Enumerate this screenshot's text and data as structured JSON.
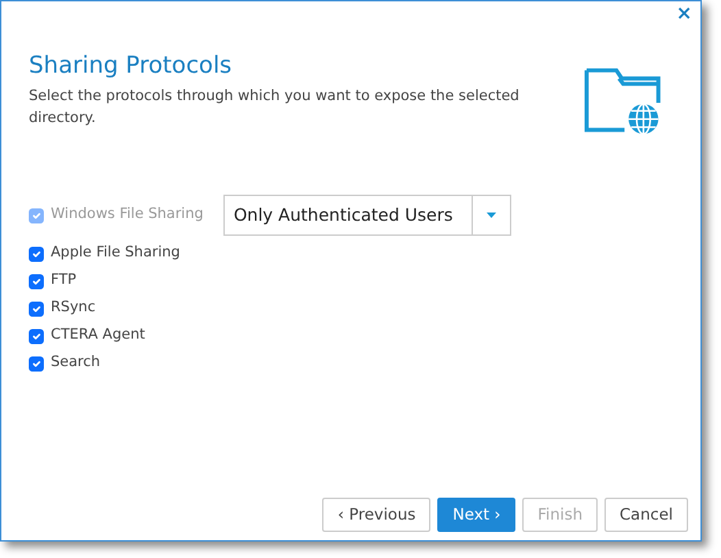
{
  "close": "×",
  "title": "Sharing Protocols",
  "subtitle": "Select the protocols through which you want to expose the selected directory.",
  "protocols": [
    {
      "label": "Windows File Sharing",
      "checked": true,
      "disabled": true,
      "select": {
        "value": "Only Authenticated Users"
      }
    },
    {
      "label": "Apple File Sharing",
      "checked": true,
      "disabled": false
    },
    {
      "label": "FTP",
      "checked": true,
      "disabled": false
    },
    {
      "label": "RSync",
      "checked": true,
      "disabled": false
    },
    {
      "label": "CTERA Agent",
      "checked": true,
      "disabled": false
    },
    {
      "label": "Search",
      "checked": true,
      "disabled": false
    }
  ],
  "buttons": [
    {
      "label": "‹ Previous",
      "kind": "default",
      "disabled": false
    },
    {
      "label": "Next ›",
      "kind": "primary",
      "disabled": false
    },
    {
      "label": "Finish",
      "kind": "default",
      "disabled": true
    },
    {
      "label": "Cancel",
      "kind": "default",
      "disabled": false
    }
  ]
}
